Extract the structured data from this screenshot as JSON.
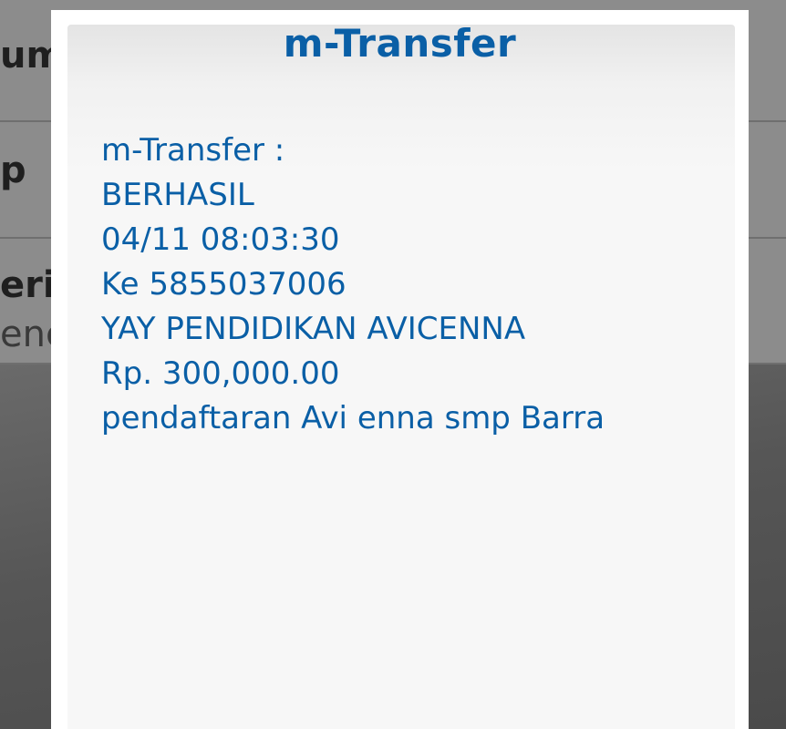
{
  "background": {
    "row1_fragment": "um",
    "row2_fragment": "p",
    "row3_fragment": "erit",
    "row3_sub_fragment": "enc"
  },
  "modal": {
    "title": "m-Transfer",
    "lines": [
      "m-Transfer :",
      "BERHASIL",
      "04/11 08:03:30",
      "Ke 5855037006",
      "YAY PENDIDIKAN AVICENNA",
      "Rp. 300,000.00",
      "pendaftaran Avi enna smp Barra"
    ]
  },
  "colors": {
    "accent": "#0a5fa6",
    "modal_background": "#f7f7f7",
    "dim_overlay": "#5a5a5a"
  }
}
